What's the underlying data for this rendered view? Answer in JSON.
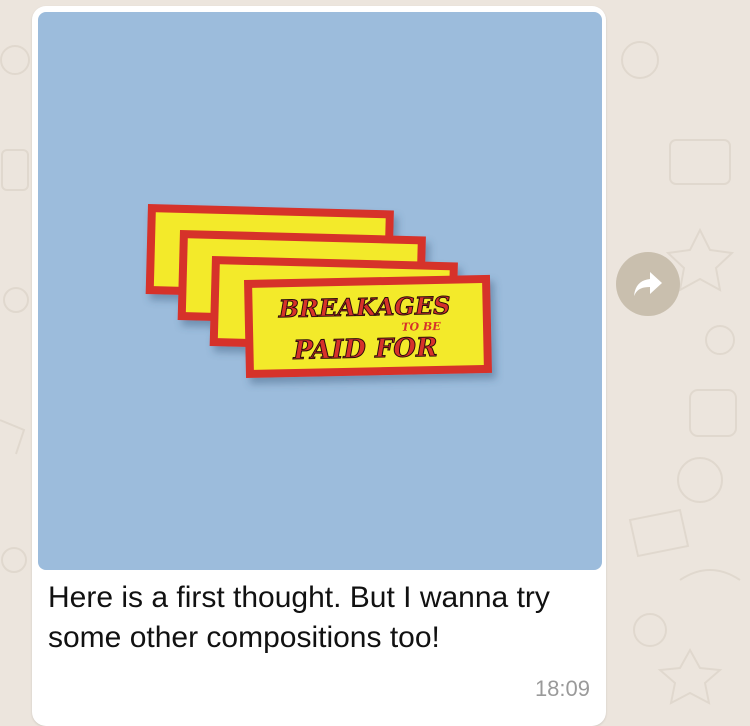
{
  "message": {
    "caption": "Here is a first thought. But I wanna try some other compositions too!",
    "timestamp": "18:09"
  },
  "sticker": {
    "line1": "BREAKAGES",
    "line2": "TO BE",
    "line3": "PAID FOR"
  },
  "colors": {
    "chat_background": "#ece5dd",
    "photo_background": "#9cbcdc",
    "sign_yellow": "#f3ea2b",
    "sign_red": "#d6322b",
    "forward_button": "#c9bfae"
  },
  "icons": {
    "forward": "forward-arrow-icon"
  }
}
